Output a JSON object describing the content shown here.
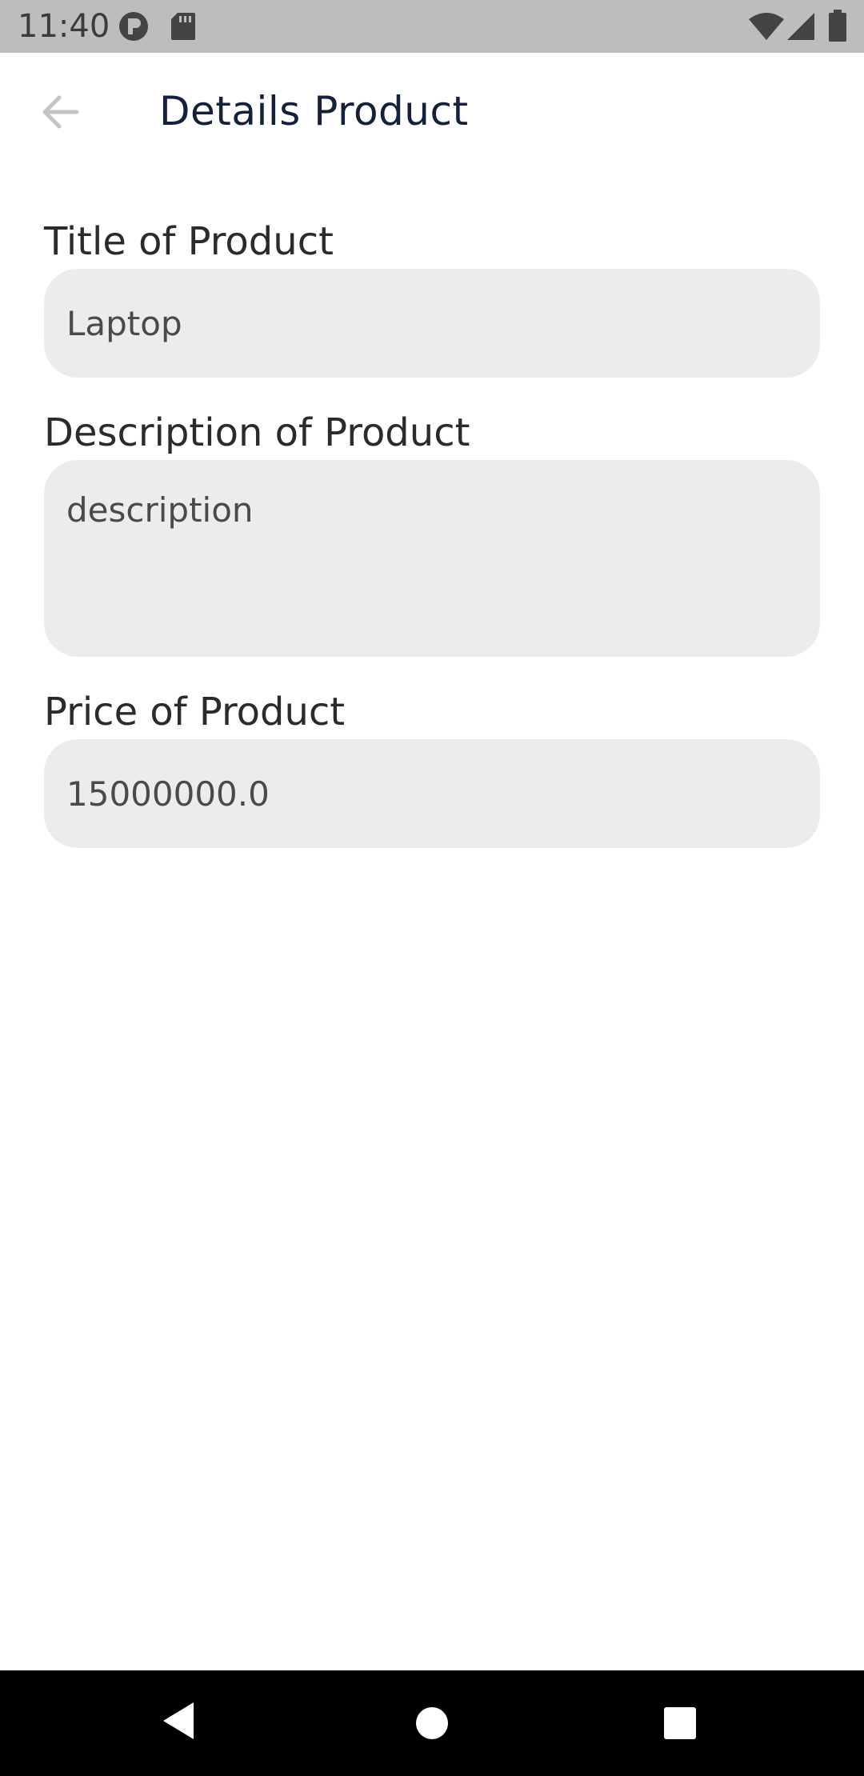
{
  "status_bar": {
    "time": "11:40",
    "left_icons": [
      "circle-p-icon",
      "sd-card-icon"
    ],
    "right_icons": [
      "wifi-icon",
      "signal-icon",
      "battery-icon"
    ]
  },
  "app_bar": {
    "back_icon": "arrow-left-icon",
    "title": "Details Product"
  },
  "form": {
    "title_label": "Title of Product",
    "title_value": "Laptop",
    "description_label": "Description of Product",
    "description_value": "description",
    "price_label": "Price of Product",
    "price_value": "15000000.0"
  },
  "nav_bar": {
    "back": "back-triangle-icon",
    "home": "home-circle-icon",
    "recents": "recents-square-icon"
  },
  "colors": {
    "status_bar_bg": "#bdbdbd",
    "title_text": "#13213a",
    "field_bg": "#ececec",
    "nav_bg": "#000000"
  }
}
